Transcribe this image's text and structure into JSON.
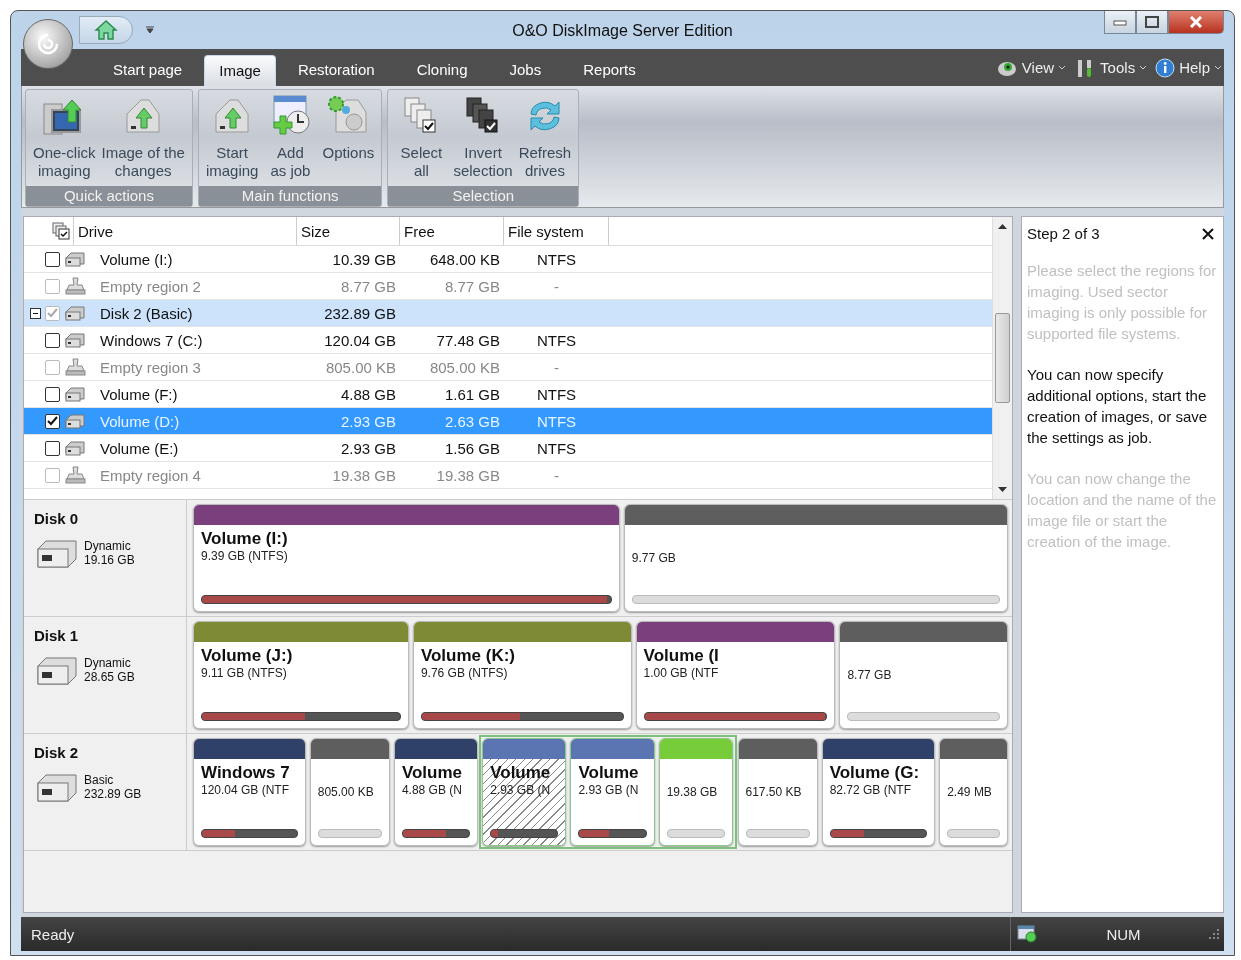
{
  "window": {
    "title": "O&O DiskImage Server Edition"
  },
  "tabs": [
    {
      "label": "Start page",
      "selected": false
    },
    {
      "label": "Image",
      "selected": true
    },
    {
      "label": "Restoration",
      "selected": false
    },
    {
      "label": "Cloning",
      "selected": false
    },
    {
      "label": "Jobs",
      "selected": false
    },
    {
      "label": "Reports",
      "selected": false
    }
  ],
  "menus": [
    {
      "label": "View",
      "kind": "eye"
    },
    {
      "label": "Tools",
      "kind": "tools"
    },
    {
      "label": "Help",
      "kind": "info"
    }
  ],
  "ribbon": [
    {
      "label": "Quick actions",
      "buttons": [
        {
          "lines": [
            "One-click",
            "imaging"
          ],
          "kind": "monitor"
        },
        {
          "lines": [
            "Image of the",
            "changes"
          ],
          "kind": "drive"
        }
      ]
    },
    {
      "label": "Main functions",
      "buttons": [
        {
          "lines": [
            "Start",
            "imaging"
          ],
          "kind": "drive"
        },
        {
          "lines": [
            "Add",
            "as job"
          ],
          "kind": "clock"
        },
        {
          "lines": [
            "Options"
          ],
          "kind": "gear"
        }
      ]
    },
    {
      "label": "Selection",
      "buttons": [
        {
          "lines": [
            "Select",
            "all"
          ],
          "kind": "pages"
        },
        {
          "lines": [
            "Invert",
            "selection"
          ],
          "kind": "darkpages"
        },
        {
          "lines": [
            "Refresh",
            "drives"
          ],
          "kind": "refresh"
        }
      ]
    }
  ],
  "table": {
    "columns": [
      "Drive",
      "Size",
      "Free",
      "File system"
    ],
    "rows": [
      {
        "kind": "volume",
        "name": "Volume (I:)",
        "size": "10.39 GB",
        "free": "648.00 KB",
        "fs": "NTFS",
        "checked": false,
        "disabled": false,
        "selected": false
      },
      {
        "kind": "empty",
        "name": "Empty region 2",
        "size": "8.77 GB",
        "free": "8.77 GB",
        "fs": "-",
        "checked": false,
        "disabled": true,
        "selected": false
      },
      {
        "kind": "disk",
        "name": "Disk 2 (Basic)",
        "size": "232.89 GB",
        "checked": true,
        "disabled": true,
        "selected": false,
        "expanded": true
      },
      {
        "kind": "volume",
        "name": "Windows 7 (C:)",
        "size": "120.04 GB",
        "free": "77.48 GB",
        "fs": "NTFS",
        "checked": false,
        "disabled": false,
        "selected": false
      },
      {
        "kind": "empty",
        "name": "Empty region 3",
        "size": "805.00 KB",
        "free": "805.00 KB",
        "fs": "-",
        "checked": false,
        "disabled": true,
        "selected": false
      },
      {
        "kind": "volume",
        "name": "Volume (F:)",
        "size": "4.88 GB",
        "free": "1.61 GB",
        "fs": "NTFS",
        "checked": false,
        "disabled": false,
        "selected": false
      },
      {
        "kind": "volume",
        "name": "Volume (D:)",
        "size": "2.93 GB",
        "free": "2.63 GB",
        "fs": "NTFS",
        "checked": true,
        "disabled": false,
        "selected": true
      },
      {
        "kind": "volume",
        "name": "Volume (E:)",
        "size": "2.93 GB",
        "free": "1.56 GB",
        "fs": "NTFS",
        "checked": false,
        "disabled": false,
        "selected": false
      },
      {
        "kind": "empty",
        "name": "Empty region 4",
        "size": "19.38 GB",
        "free": "19.38 GB",
        "fs": "-",
        "checked": false,
        "disabled": true,
        "selected": false
      }
    ]
  },
  "disks": [
    {
      "name": "Disk 0",
      "type": "Dynamic",
      "size": "19.16 GB",
      "partitions": [
        {
          "kind": "volume",
          "title": "Volume (I:)",
          "info": "9.39 GB (NTFS)",
          "color": "#7b3f7e",
          "level": 0.99,
          "selected": false,
          "checked": false
        },
        {
          "kind": "free",
          "info": "9.77 GB",
          "color": "#5e5e5e",
          "selected": false,
          "checked": false
        }
      ]
    },
    {
      "name": "Disk 1",
      "type": "Dynamic",
      "size": "28.65 GB",
      "partitions": [
        {
          "kind": "volume",
          "title": "Volume (J:)",
          "info": "9.11 GB (NTFS)",
          "color": "#7f8a34",
          "level": 0.52,
          "selected": false,
          "checked": false
        },
        {
          "kind": "volume",
          "title": "Volume (K:)",
          "info": "9.76 GB (NTFS)",
          "color": "#7f8a34",
          "level": 0.49,
          "selected": false,
          "checked": false
        },
        {
          "kind": "volume",
          "title": "Volume (I",
          "info": "1.00 GB (NTF",
          "color": "#7b3f7e",
          "level": 0.99,
          "selected": false,
          "checked": false
        },
        {
          "kind": "free",
          "info": "8.77 GB",
          "color": "#5e5e5e",
          "selected": false,
          "checked": false
        }
      ]
    },
    {
      "name": "Disk 2",
      "type": "Basic",
      "size": "232.89 GB",
      "partitions": [
        {
          "kind": "volume",
          "title": "Windows 7",
          "info": "120.04 GB (NTF",
          "color": "#2f4168",
          "level": 0.35,
          "selected": false,
          "checked": false
        },
        {
          "kind": "free",
          "info": "805.00 KB",
          "color": "#5e5e5e",
          "selected": false,
          "checked": false
        },
        {
          "kind": "volume",
          "title": "Volume",
          "info": "4.88 GB (N",
          "color": "#2f4168",
          "level": 0.65,
          "selected": false,
          "checked": false
        },
        {
          "kind": "volume",
          "title": "Volume",
          "info": "2.93 GB (N",
          "color": "#5b74b2",
          "level": 0.1,
          "selected": true,
          "checked": true
        },
        {
          "kind": "volume",
          "title": "Volume",
          "info": "2.93 GB (N",
          "color": "#5b74b2",
          "level": 0.45,
          "selected": true,
          "checked": false
        },
        {
          "kind": "free",
          "info": "19.38 GB",
          "color": "#77cc3a",
          "selected": true,
          "checked": false
        },
        {
          "kind": "free",
          "info": "617.50 KB",
          "color": "#5e5e5e",
          "selected": false,
          "checked": false
        },
        {
          "kind": "volume",
          "title": "Volume (G:",
          "info": "82.72 GB (NTF",
          "color": "#2f4168",
          "level": 0.35,
          "selected": false,
          "checked": false
        },
        {
          "kind": "free",
          "info": "2.49 MB",
          "color": "#5e5e5e",
          "selected": false,
          "checked": false
        }
      ]
    }
  ],
  "guide": {
    "title": "Step 2 of 3",
    "paragraphs": [
      {
        "text": "Please select the regions for imaging. Used sector imaging is only possible for supported file systems.",
        "active": false
      },
      {
        "text": "You can now specify additional options, start the creation of images, or save the settings as job.",
        "active": true
      },
      {
        "text": "You can now change the location and the name of the image file or start the creation of the image.",
        "active": false
      }
    ]
  },
  "status_bar": {
    "text": "Ready",
    "indicator": "NUM"
  }
}
